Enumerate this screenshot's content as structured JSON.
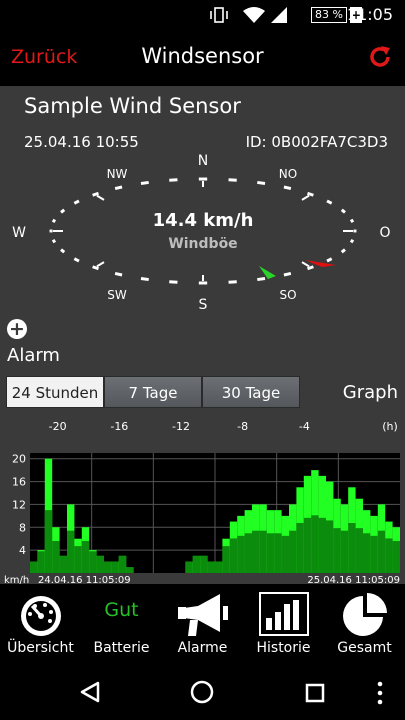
{
  "status": {
    "battery": "83 %",
    "time": "11:05"
  },
  "header": {
    "back_label": "Zurück",
    "title": "Windsensor"
  },
  "sensor": {
    "name": "Sample Wind Sensor",
    "datetime": "25.04.16  10:55",
    "id": "ID: 0B002FA7C3D3",
    "speed": "14.4 km/h",
    "speed_caption": "Windböe"
  },
  "compass": {
    "N": "N",
    "NO": "NO",
    "O": "O",
    "SO": "SO",
    "S": "S",
    "SW": "SW",
    "W": "W",
    "NW": "NW"
  },
  "alarm": {
    "label": "Alarm"
  },
  "range_tabs": [
    "24 Stunden",
    "7 Tage",
    "30 Tage"
  ],
  "graph_label": "Graph",
  "chart_data": {
    "type": "bar",
    "xlabel": "(h)",
    "ylabel": "km/h",
    "x_ticks": [
      "-20",
      "-16",
      "-12",
      "-8",
      "-4"
    ],
    "y_ticks": [
      "20",
      "16",
      "12",
      "8",
      "4"
    ],
    "ylim": [
      0,
      21
    ],
    "start_label": "24.04.16  11:05:09",
    "end_label": "25.04.16  11:05:09",
    "series": [
      {
        "values": [
          2,
          4,
          20,
          8,
          3,
          12,
          6,
          8,
          4,
          3,
          2,
          2,
          3,
          1,
          0,
          0,
          0,
          0,
          0,
          0,
          0,
          2,
          3,
          3,
          2,
          2,
          6,
          9,
          10,
          11,
          12,
          12,
          11,
          11,
          10,
          12,
          15,
          17,
          18,
          17,
          16,
          13,
          12,
          15,
          13,
          11,
          10,
          12,
          9,
          8
        ]
      }
    ],
    "colors": {
      "gust": "#22ff22",
      "mean": "#0c8c0c",
      "background": "#000000",
      "grid": "#555555"
    }
  },
  "bottom_nav": [
    {
      "label": "Übersicht",
      "icon": "gauge-icon"
    },
    {
      "label": "Batterie",
      "icon_text": "Gut"
    },
    {
      "label": "Alarme",
      "icon": "megaphone-icon"
    },
    {
      "label": "Historie",
      "icon": "bar-chart-icon"
    },
    {
      "label": "Gesamt",
      "icon": "pie-chart-icon"
    }
  ],
  "colors": {
    "accent": "#e01818",
    "background": "#3a3a3a",
    "ok": "#28c028"
  }
}
